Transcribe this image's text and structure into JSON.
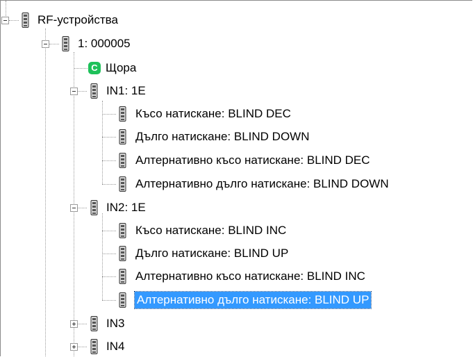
{
  "tree": {
    "root": {
      "label": "RF-устройства",
      "expanded": true
    },
    "device": {
      "label": "1: 000005",
      "expanded": true
    },
    "scene": {
      "label": "Щора",
      "icon": "scene-c-icon",
      "icon_letter": "C",
      "icon_color": "#1ec15a"
    },
    "in1": {
      "label": "IN1: 1E",
      "expanded": true,
      "children": [
        "Късо натискане: BLIND DEC",
        "Дълго натискане: BLIND DOWN",
        "Алтернативно късо натискане: BLIND DEC",
        "Алтернативно дълго натискане: BLIND DOWN"
      ]
    },
    "in2": {
      "label": "IN2: 1E",
      "expanded": true,
      "children": [
        "Късо натискане: BLIND INC",
        "Дълго натискане: BLIND UP",
        "Алтернативно късо натискане: BLIND INC",
        "Алтернативно дълго натискане: BLIND UP"
      ],
      "selected_child_index": 3
    },
    "in3": {
      "label": "IN3",
      "expanded": false
    },
    "in4": {
      "label": "IN4",
      "expanded": false
    }
  },
  "colors": {
    "selection": "#3399ff",
    "device_icon": "#555555"
  }
}
